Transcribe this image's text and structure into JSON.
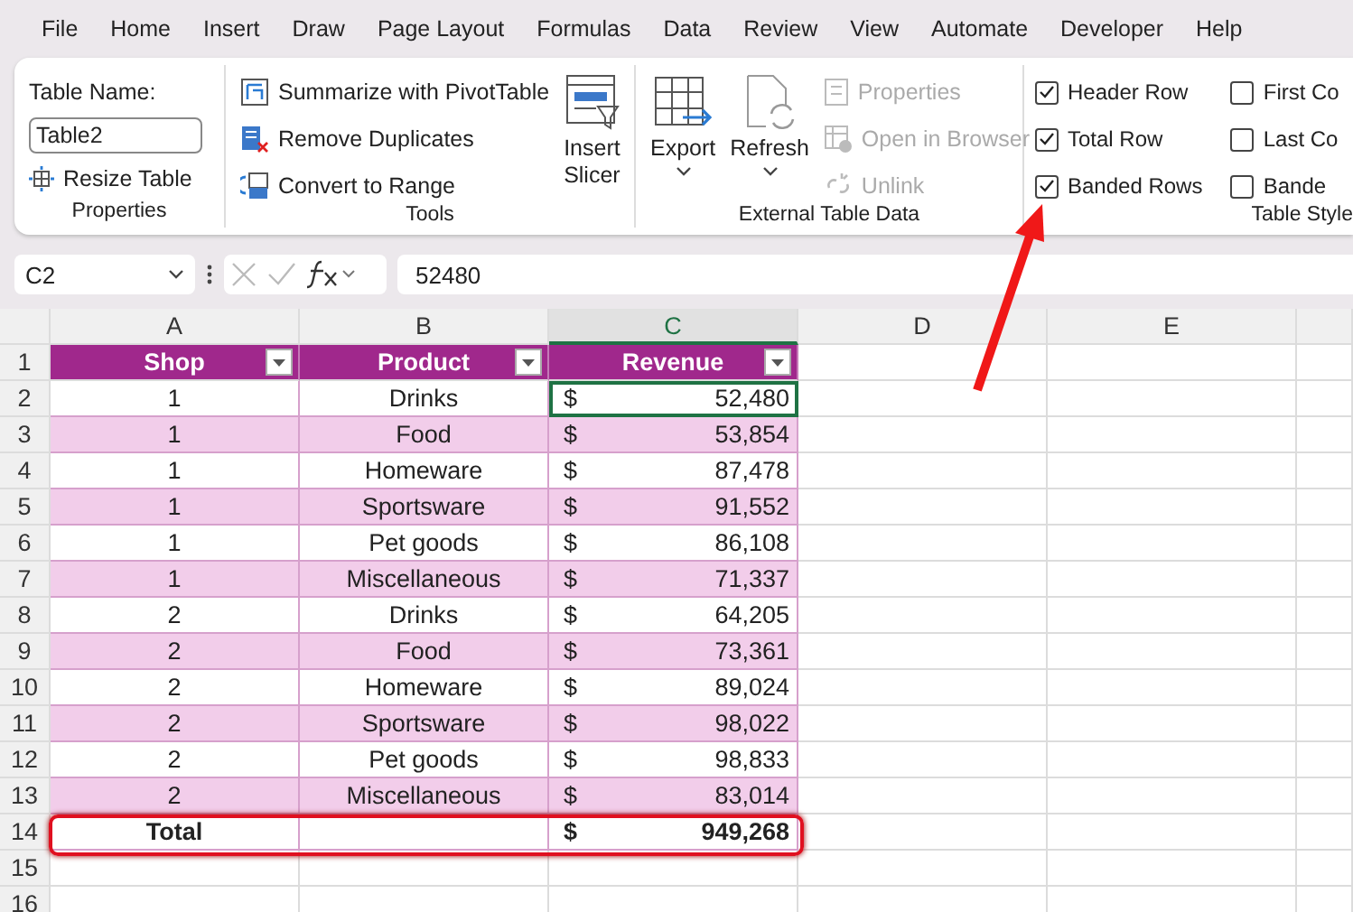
{
  "menu": [
    "File",
    "Home",
    "Insert",
    "Draw",
    "Page Layout",
    "Formulas",
    "Data",
    "Review",
    "View",
    "Automate",
    "Developer",
    "Help"
  ],
  "ribbon": {
    "properties": {
      "name_label": "Table Name:",
      "name_value": "Table2",
      "resize": "Resize Table",
      "label": "Properties"
    },
    "tools": {
      "items": [
        "Summarize with PivotTable",
        "Remove Duplicates",
        "Convert to Range"
      ],
      "slicer": "Insert Slicer",
      "label": "Tools"
    },
    "external": {
      "export": "Export",
      "refresh": "Refresh",
      "items": [
        {
          "label": "Properties",
          "disabled": true
        },
        {
          "label": "Open in Browser",
          "disabled": true
        },
        {
          "label": "Unlink",
          "disabled": true
        }
      ],
      "label": "External Table Data"
    },
    "style_options": {
      "options": [
        {
          "label": "Header Row",
          "checked": true
        },
        {
          "label": "Total Row",
          "checked": true
        },
        {
          "label": "Banded Rows",
          "checked": true
        },
        {
          "label": "First Co",
          "checked": false
        },
        {
          "label": "Last Co",
          "checked": false
        },
        {
          "label": "Bande",
          "checked": false
        }
      ],
      "label": "Table Style"
    }
  },
  "formula_bar": {
    "name_box": "C2",
    "formula": "52480"
  },
  "columns": [
    {
      "label": "A",
      "selected": false
    },
    {
      "label": "B",
      "selected": false
    },
    {
      "label": "C",
      "selected": true
    },
    {
      "label": "D",
      "selected": false
    },
    {
      "label": "E",
      "selected": false
    }
  ],
  "row_numbers": [
    "1",
    "2",
    "3",
    "4",
    "5",
    "6",
    "7",
    "8",
    "9",
    "10",
    "11",
    "12",
    "13",
    "14",
    "15",
    "16"
  ],
  "table": {
    "headers": [
      "Shop",
      "Product",
      "Revenue"
    ],
    "rows": [
      {
        "shop": "1",
        "product": "Drinks",
        "currency": "$",
        "revenue": "52,480",
        "selected": true
      },
      {
        "shop": "1",
        "product": "Food",
        "currency": "$",
        "revenue": "53,854",
        "selected": false
      },
      {
        "shop": "1",
        "product": "Homeware",
        "currency": "$",
        "revenue": "87,478",
        "selected": false
      },
      {
        "shop": "1",
        "product": "Sportsware",
        "currency": "$",
        "revenue": "91,552",
        "selected": false
      },
      {
        "shop": "1",
        "product": "Pet goods",
        "currency": "$",
        "revenue": "86,108",
        "selected": false
      },
      {
        "shop": "1",
        "product": "Miscellaneous",
        "currency": "$",
        "revenue": "71,337",
        "selected": false
      },
      {
        "shop": "2",
        "product": "Drinks",
        "currency": "$",
        "revenue": "64,205",
        "selected": false
      },
      {
        "shop": "2",
        "product": "Food",
        "currency": "$",
        "revenue": "73,361",
        "selected": false
      },
      {
        "shop": "2",
        "product": "Homeware",
        "currency": "$",
        "revenue": "89,024",
        "selected": false
      },
      {
        "shop": "2",
        "product": "Sportsware",
        "currency": "$",
        "revenue": "98,022",
        "selected": false
      },
      {
        "shop": "2",
        "product": "Pet goods",
        "currency": "$",
        "revenue": "98,833",
        "selected": false
      },
      {
        "shop": "2",
        "product": "Miscellaneous",
        "currency": "$",
        "revenue": "83,014",
        "selected": false
      }
    ],
    "total": {
      "label": "Total",
      "currency": "$",
      "revenue": "949,268"
    }
  }
}
